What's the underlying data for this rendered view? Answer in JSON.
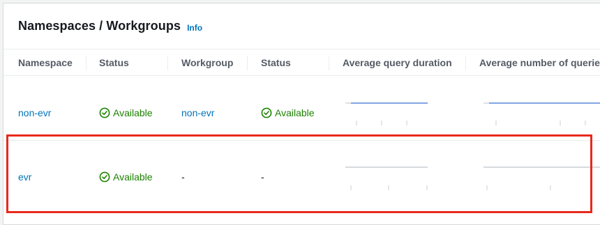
{
  "panel": {
    "title": "Namespaces / Workgroups",
    "info_label": "Info"
  },
  "columns": [
    "Namespace",
    "Status",
    "Workgroup",
    "Status",
    "Average query duration",
    "Average number of queries"
  ],
  "rows": [
    {
      "namespace": "non-evr",
      "namespace_status": "Available",
      "workgroup": "non-evr",
      "workgroup_status": "Available",
      "sparkline_color": "#5a87d9"
    },
    {
      "namespace": "evr",
      "namespace_status": "Available",
      "workgroup": "-",
      "workgroup_status": "-",
      "sparkline_color": "#c9cdd1"
    }
  ],
  "colors": {
    "link": "#0073bb",
    "status_ok": "#1d8102",
    "highlight": "#e8291c"
  }
}
